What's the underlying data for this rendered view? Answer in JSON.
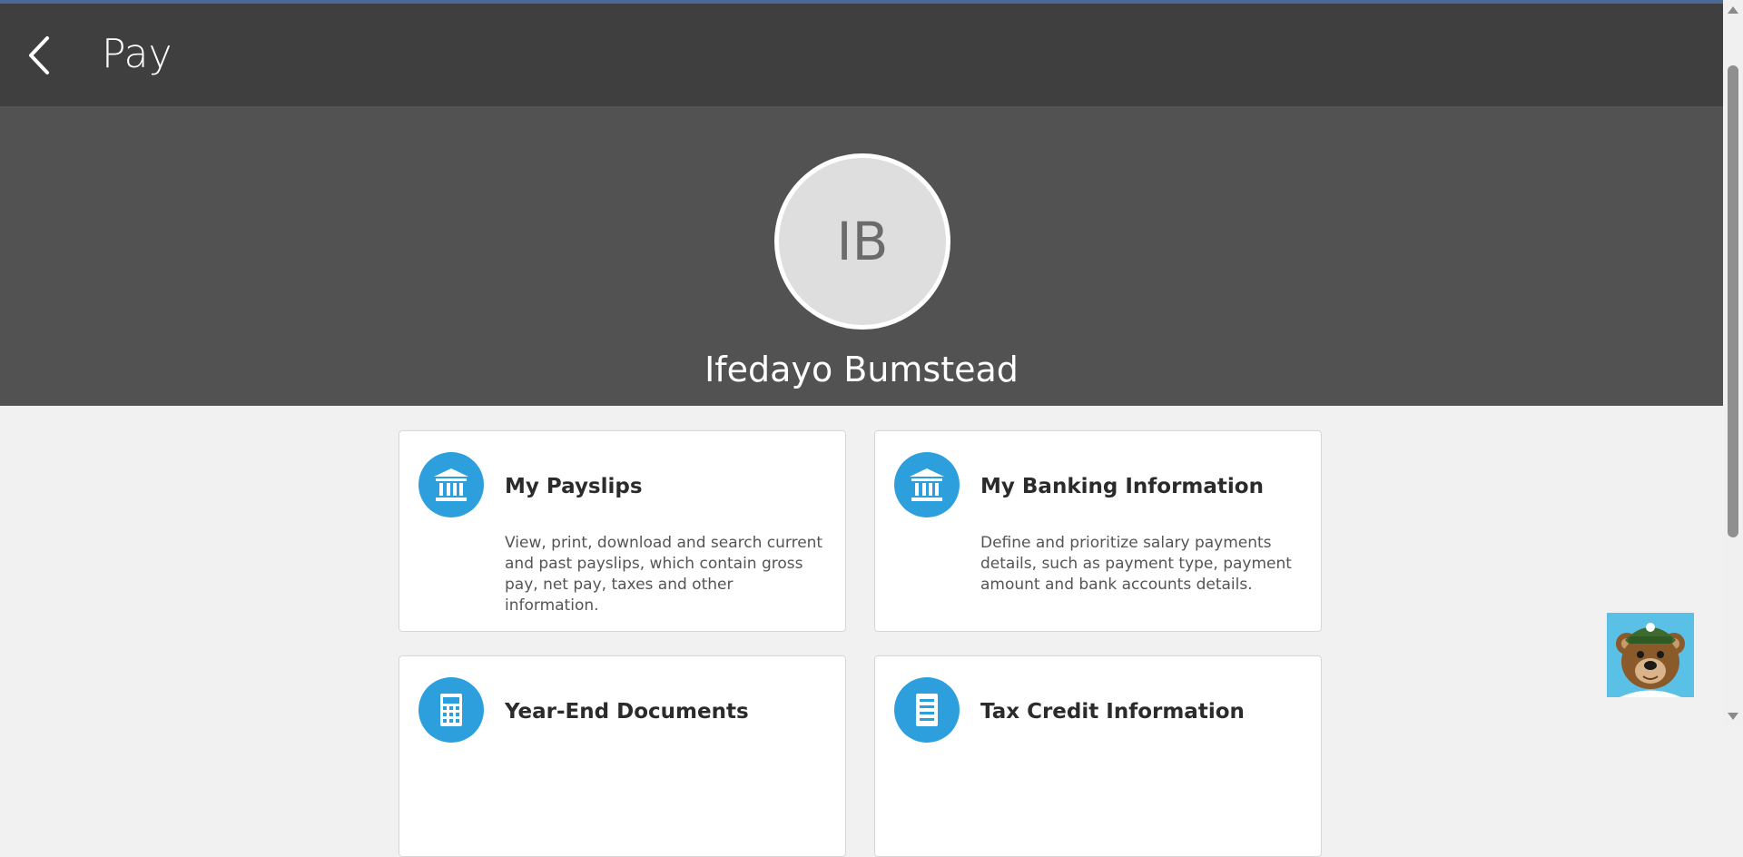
{
  "header": {
    "title": "Pay"
  },
  "profile": {
    "initials": "IB",
    "name": "Ifedayo Bumstead"
  },
  "cards": [
    {
      "title": "My Payslips",
      "description": "View, print, download and search current and past payslips, which contain gross pay, net pay, taxes and other information.",
      "icon": "bank-icon"
    },
    {
      "title": "My Banking Information",
      "description": "Define and prioritize salary payments details, such as payment type, payment amount and bank accounts details.",
      "icon": "bank-icon"
    },
    {
      "title": "Year-End Documents",
      "description": "",
      "icon": "calculator-icon"
    },
    {
      "title": "Tax Credit Information",
      "description": "",
      "icon": "document-icon"
    }
  ],
  "colors": {
    "accent": "#2d9fdc",
    "header": "#3f3f3f",
    "banner": "#525252"
  }
}
